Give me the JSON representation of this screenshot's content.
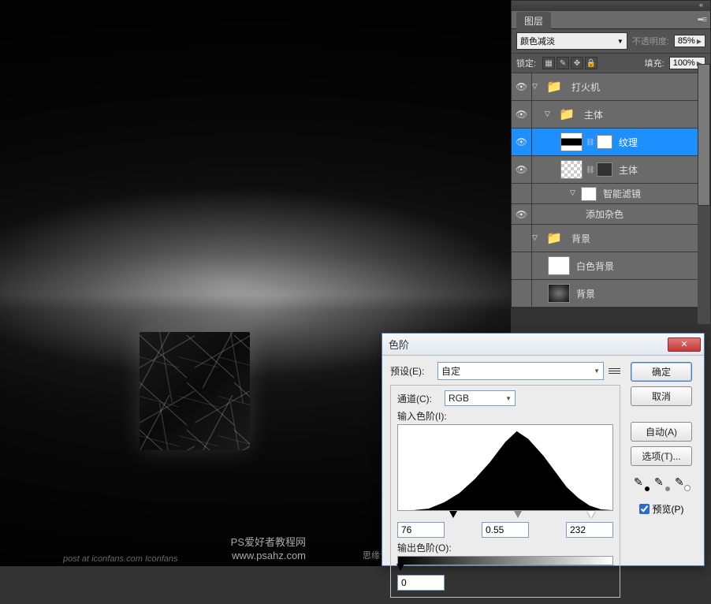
{
  "watermarks": {
    "left": "post at iconfans.com  Iconfans",
    "center": "思缘设计论坛",
    "right_line1": "PS爱好者教程网",
    "right_line2": "www.psahz.com"
  },
  "layers_panel": {
    "title": "图层",
    "blend_mode": "颜色减淡",
    "opacity_label": "不透明度:",
    "opacity_value": "85%",
    "lock_label": "锁定:",
    "fill_label": "填充:",
    "fill_value": "100%",
    "items": [
      {
        "eye": "●",
        "indent": 0,
        "toggle": "▽",
        "type": "folder",
        "label": "打火机"
      },
      {
        "eye": "●",
        "indent": 1,
        "toggle": "▽",
        "type": "folder",
        "label": "主体"
      },
      {
        "eye": "●",
        "indent": 2,
        "toggle": "",
        "type": "layer-mask",
        "label": "纹理",
        "selected": true
      },
      {
        "eye": "●",
        "indent": 2,
        "toggle": "",
        "type": "smart",
        "label": "主体",
        "fx": true
      },
      {
        "eye": "",
        "indent": 3,
        "toggle": "▽",
        "type": "text",
        "label": "智能滤镜"
      },
      {
        "eye": "●",
        "indent": 4,
        "toggle": "",
        "type": "text",
        "label": "添加杂色"
      },
      {
        "eye": "",
        "indent": 0,
        "toggle": "▽",
        "type": "folder",
        "label": "背景"
      },
      {
        "eye": "",
        "indent": 1,
        "toggle": "",
        "type": "white",
        "label": "白色背景"
      },
      {
        "eye": "",
        "indent": 1,
        "toggle": "",
        "type": "dark",
        "label": "背景"
      }
    ]
  },
  "levels": {
    "title": "色阶",
    "preset_label": "预设(E):",
    "preset_value": "自定",
    "channel_label": "通道(C):",
    "channel_value": "RGB",
    "input_label": "输入色阶(I):",
    "output_label": "输出色阶(O):",
    "shadow": "76",
    "mid": "0.55",
    "highlight": "232",
    "out_shadow": "0",
    "ok": "确定",
    "cancel": "取消",
    "auto": "自动(A)",
    "options": "选项(T)...",
    "preview": "预览(P)"
  }
}
